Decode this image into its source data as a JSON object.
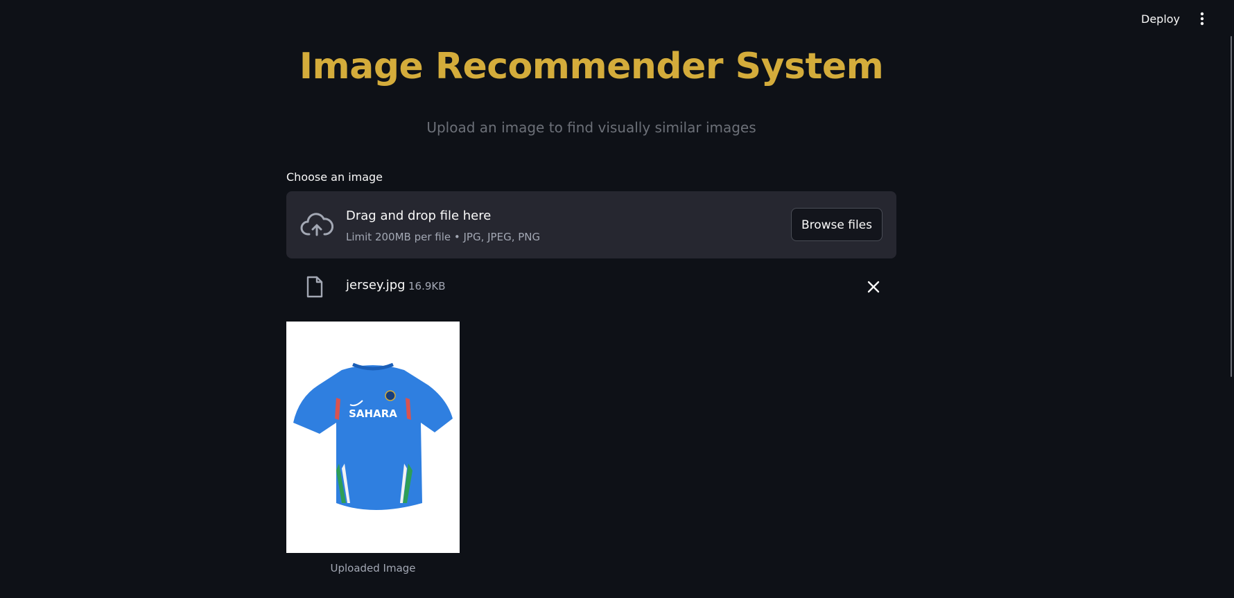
{
  "header": {
    "deploy_label": "Deploy",
    "menu_icon": "kebab-menu-icon"
  },
  "page": {
    "title": "Image Recommender System",
    "subtitle": "Upload an image to find visually similar images"
  },
  "uploader": {
    "label": "Choose an image",
    "drop_title": "Drag and drop file here",
    "limit_text": "Limit 200MB per file • JPG, JPEG, PNG",
    "browse_label": "Browse files",
    "icon": "cloud-upload-icon"
  },
  "uploaded_file": {
    "name": "jersey.jpg",
    "size": "16.9KB",
    "icon": "file-icon",
    "remove_icon": "close-icon"
  },
  "preview": {
    "caption": "Uploaded Image",
    "jersey_text": "SAHARA"
  },
  "colors": {
    "background": "#0e1117",
    "title": "#d4ac3b",
    "dropzone": "#262730",
    "jersey_blue": "#2f7fe0"
  }
}
